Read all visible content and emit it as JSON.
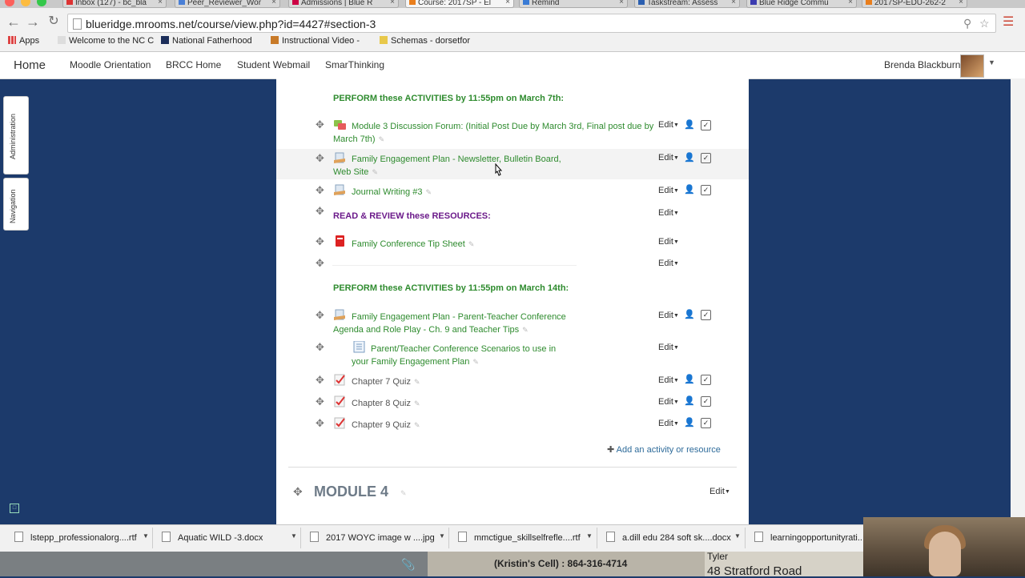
{
  "browser": {
    "tabs": [
      {
        "label": "Inbox (127) - bc_bla",
        "active": false
      },
      {
        "label": "Peer_Reviewer_Wor",
        "active": false
      },
      {
        "label": "Admissions | Blue R",
        "active": false
      },
      {
        "label": "Course: 2017SP - El",
        "active": true
      },
      {
        "label": "Remind",
        "active": false
      },
      {
        "label": "Taskstream: Assess",
        "active": false
      },
      {
        "label": "Blue Ridge Commu",
        "active": false
      },
      {
        "label": "2017SP-EDU-262-2",
        "active": false
      }
    ],
    "url": "blueridge.mrooms.net/course/view.php?id=4427#section-3",
    "bookmarks": [
      "Apps",
      "Welcome to the NC C",
      "National Fatherhood",
      "Instructional Video -",
      "Schemas - dorsetfor"
    ]
  },
  "moodle_nav": {
    "brand": "Home",
    "links": [
      "Moodle Orientation",
      "BRCC Home",
      "Student Webmail",
      "SmarThinking"
    ],
    "user_name": "Brenda Blackburn"
  },
  "side_blocks": {
    "administration": "Administration",
    "navigation": "Navigation"
  },
  "section": {
    "edit_label": "Edit",
    "labels": {
      "perform_march7": "PERFORM these ACTIVITIES by 11:55pm on March 7th:",
      "read_review": "READ & REVIEW these RESOURCES:",
      "perform_march14": "PERFORM these ACTIVITIES by 11:55pm on March 14th:"
    },
    "activities": {
      "forum": "Module 3 Discussion Forum: (Initial Post Due by March 3rd, Final post due by",
      "forum_line2": "March 7th)",
      "fep_newsletter": "Family Engagement Plan - Newsletter, Bulletin Board,",
      "fep_newsletter_line2": "Web Site",
      "journal": "Journal Writing #3",
      "tip_sheet": "Family Conference Tip Sheet",
      "fep_conference": "Family Engagement Plan - Parent-Teacher Conference",
      "fep_conference_line2": "Agenda and Role Play - Ch. 9 and Teacher Tips",
      "scenarios": "Parent/Teacher Conference Scenarios to use in",
      "scenarios_line2": "your Family Engagement Plan",
      "quiz7": "Chapter 7 Quiz",
      "quiz8": "Chapter 8 Quiz",
      "quiz9": "Chapter 9 Quiz"
    },
    "add_activity": "Add an activity or resource"
  },
  "next_module": {
    "title": "MODULE 4",
    "edit": "Edit"
  },
  "downloads": [
    "lstepp_professionalorg....rtf",
    "Aquatic WILD -3.docx",
    "2017 WOYC image w ....jpg",
    "mmctigue_skillselfrefle....rtf",
    "a.dill edu 284 soft sk....docx",
    "learningopportunityrati..."
  ],
  "background_text": {
    "phone": "(Kristin's Cell) : 864-316-4714",
    "name": "Tyler",
    "street": "48 Stratford Road"
  },
  "colors": {
    "page_bg": "#1c3a6b",
    "activity_link": "#2e8b2e",
    "resource_label": "#6b1a8a"
  }
}
